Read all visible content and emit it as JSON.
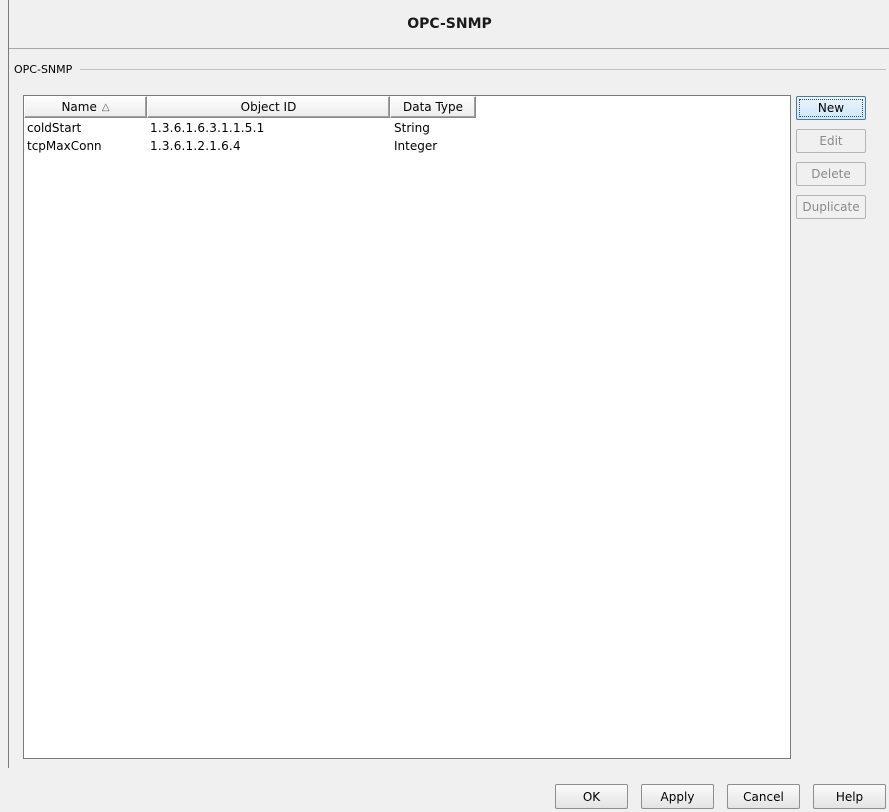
{
  "dialog": {
    "title": "OPC-SNMP"
  },
  "section": {
    "label": "OPC-SNMP"
  },
  "table": {
    "columns": [
      {
        "label": "Name",
        "sorted": "ascending"
      },
      {
        "label": "Object ID"
      },
      {
        "label": "Data Type"
      }
    ],
    "rows": [
      {
        "name": "coldStart",
        "oid": "1.3.6.1.6.3.1.1.5.1",
        "type": "String"
      },
      {
        "name": "tcpMaxConn",
        "oid": "1.3.6.1.2.1.6.4",
        "type": "Integer"
      }
    ]
  },
  "side_buttons": {
    "new": "New",
    "edit": "Edit",
    "delete": "Delete",
    "duplicate": "Duplicate"
  },
  "footer": {
    "ok": "OK",
    "apply": "Apply",
    "cancel": "Cancel",
    "help": "Help"
  },
  "icons": {
    "sort": "sort-ascending-icon"
  }
}
